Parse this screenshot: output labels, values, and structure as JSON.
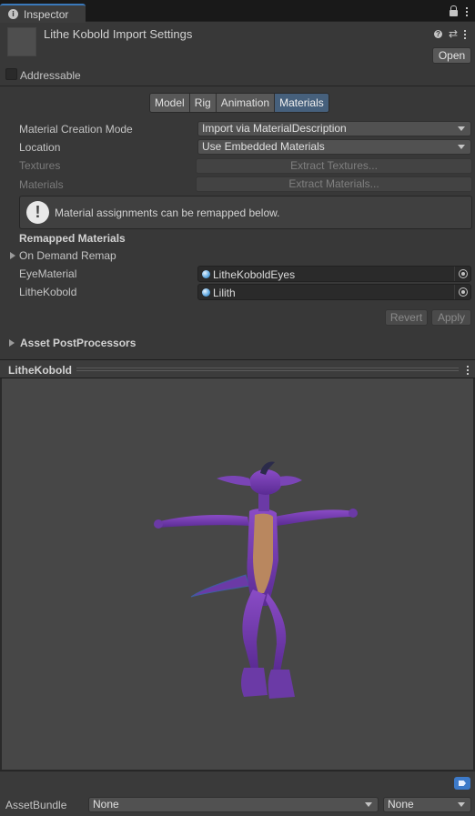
{
  "tab": {
    "title": "Inspector"
  },
  "header": {
    "title": "Lithe Kobold Import Settings",
    "open_label": "Open"
  },
  "addressable": {
    "label": "Addressable",
    "checked": false
  },
  "segments": [
    "Model",
    "Rig",
    "Animation",
    "Materials"
  ],
  "active_segment": "Materials",
  "fields": {
    "creation_mode": {
      "label": "Material Creation Mode",
      "value": "Import via MaterialDescription"
    },
    "location": {
      "label": "Location",
      "value": "Use Embedded Materials"
    },
    "textures": {
      "label": "Textures",
      "button": "Extract Textures..."
    },
    "materials": {
      "label": "Materials",
      "button": "Extract Materials..."
    }
  },
  "help": {
    "text": "Material assignments can be remapped below."
  },
  "remapped": {
    "title": "Remapped Materials",
    "on_demand": "On Demand Remap",
    "rows": [
      {
        "label": "EyeMaterial",
        "value": "LitheKoboldEyes"
      },
      {
        "label": "LitheKobold",
        "value": "Lilith"
      }
    ]
  },
  "actions": {
    "revert": "Revert",
    "apply": "Apply"
  },
  "postprocessors": {
    "label": "Asset PostProcessors"
  },
  "preview": {
    "title": "LitheKobold"
  },
  "asset_bundle": {
    "label": "AssetBundle",
    "name": "None",
    "variant": "None"
  },
  "colors": {
    "accent": "#3a79bb",
    "active_tab": "#46607c",
    "model_purple": "#7b3fb3",
    "model_skin": "#b9875f"
  }
}
